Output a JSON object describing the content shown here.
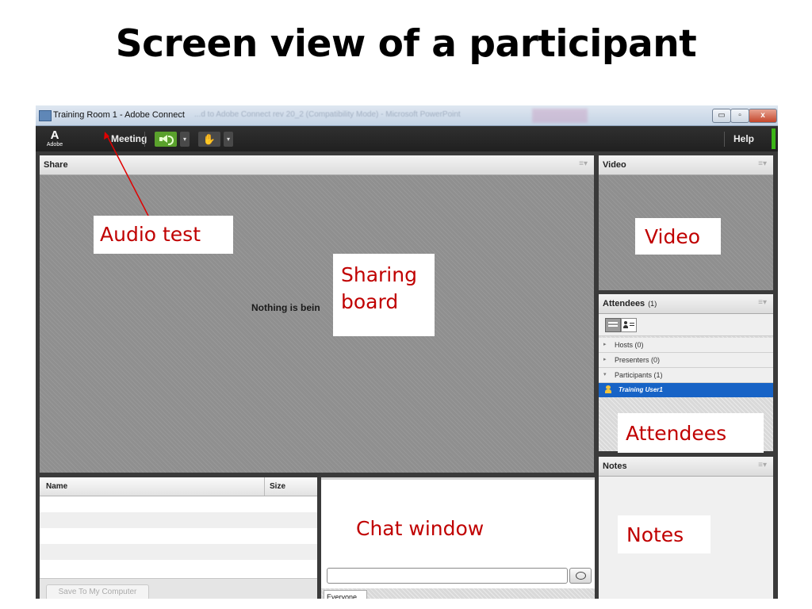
{
  "slide": {
    "title": "Screen view of a participant"
  },
  "window": {
    "title": "Training Room 1 - Adobe Connect",
    "background_caption": "...d to Adobe Connect rev 20_2 (Compatibility Mode) - Microsoft PowerPoint",
    "buttons": {
      "minimize": "▭",
      "maximize": "▫",
      "close": "x"
    }
  },
  "menubar": {
    "logo_glyph": "A",
    "logo_text": "Adobe",
    "meeting_label": "Meeting",
    "help_label": "Help",
    "dropdown_glyph": "▾",
    "status_glyph": "✋",
    "audio_color": "#5aa12c",
    "connection_color": "#3cb517"
  },
  "share_pod": {
    "title": "Share",
    "options": "≡▾",
    "message": "Nothing is bein"
  },
  "video_pod": {
    "title": "Video",
    "options": "≡▾"
  },
  "attendees_pod": {
    "title": "Attendees",
    "count": "(1)",
    "options": "≡▾",
    "groups": [
      {
        "label": "Hosts (0)",
        "arrow": "▸"
      },
      {
        "label": "Presenters (0)",
        "arrow": "▸"
      },
      {
        "label": "Participants (1)",
        "arrow": "▾"
      }
    ],
    "selected_user": "Training User1",
    "selection_color": "#1763c6"
  },
  "notes_pod": {
    "title": "Notes",
    "options": "≡▾"
  },
  "files_pod": {
    "columns": [
      "Name",
      "Size"
    ],
    "save_button": "Save To My Computer"
  },
  "chat_pod": {
    "recipient_tab": "Everyone"
  },
  "annotations": {
    "audio_test": "Audio test",
    "sharing_board_line1": "Sharing",
    "sharing_board_line2": "board",
    "video": "Video",
    "attendees": "Attendees",
    "chat_window": "Chat window",
    "notes": "Notes",
    "label_color": "#c00000",
    "arrow_color": "#e00000"
  }
}
